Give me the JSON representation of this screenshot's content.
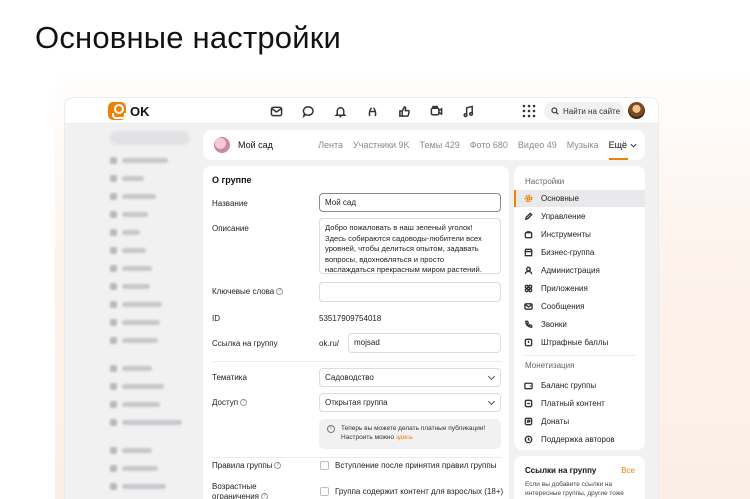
{
  "hero": {
    "title": "Основные настройки"
  },
  "topbar": {
    "logo_text": "OK",
    "search_placeholder": "Найти на сайте",
    "icons": [
      "messages-icon",
      "discussions-icon",
      "notifications-icon",
      "guests-icon",
      "likes-icon",
      "video-icon",
      "music-icon"
    ]
  },
  "group": {
    "name": "Мой сад",
    "tabs": [
      "Лента",
      "Участники 9K",
      "Темы 429",
      "Фото 680",
      "Видео 49",
      "Музыка"
    ],
    "more": "Ещё"
  },
  "form": {
    "section_title": "О группе",
    "name_label": "Название",
    "name_value": "Мой сад",
    "desc_label": "Описание",
    "desc_value": "Добро пожаловать в наш зеленый уголок! Здесь собираются садоводы-любители всех уровней, чтобы делиться опытом, задавать вопросы, вдохновляться и просто наслаждаться прекрасным миром растений.",
    "keywords_label": "Ключевые слова",
    "keywords_value": "",
    "id_label": "ID",
    "id_value": "53517909754018",
    "link_label": "Ссылка на группу",
    "link_prefix": "ok.ru/",
    "link_value": "mojsad",
    "theme_label": "Тематика",
    "theme_value": "Садоводство",
    "access_label": "Доступ",
    "access_value": "Открытая группа",
    "note_text": "Теперь вы можете делать платные публикации! Настроить можно ",
    "note_link": "здесь",
    "rules_label": "Правила группы",
    "rules_check": "Вступление после принятия правил группы",
    "age_label": "Возрастные ограничения",
    "age_check": "Группа содержит контент для взрослых (18+)"
  },
  "settings_menu": {
    "title": "Настройки",
    "items": [
      "Основные",
      "Управление",
      "Инструменты",
      "Бизнес-группа",
      "Администрация",
      "Приложения",
      "Сообщения",
      "Звонки",
      "Штрафные баллы"
    ],
    "monetization_title": "Монетизация",
    "monetization_items": [
      "Баланс группы",
      "Платный контент",
      "Донаты",
      "Поддержка авторов"
    ]
  },
  "links_card": {
    "title": "Ссылки на группу",
    "all": "Все",
    "desc": "Если вы добавите ссылки на интересные группы, другие тоже"
  },
  "colors": {
    "accent": "#ee8208",
    "panel_bg": "#f1f1f2"
  }
}
